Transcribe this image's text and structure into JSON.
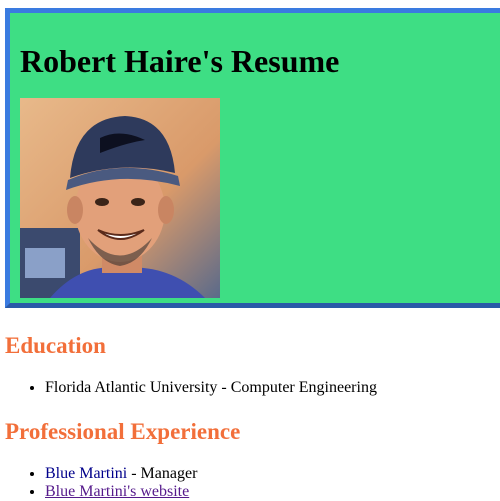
{
  "page": {
    "title": "Robert Haire's Resume"
  },
  "photo": {
    "icon": "profile-photo"
  },
  "education": {
    "heading": "Education",
    "items": [
      "Florida Atlantic University - Computer Engineering"
    ]
  },
  "experience": {
    "heading": "Professional Experience",
    "company": "Blue Martini",
    "role_suffix": " - Manager",
    "website_link": "Blue Martini's website"
  },
  "colors": {
    "header_bg": "#3ede84",
    "header_border": "#3a7be0",
    "section_heading": "#f26f3a"
  }
}
